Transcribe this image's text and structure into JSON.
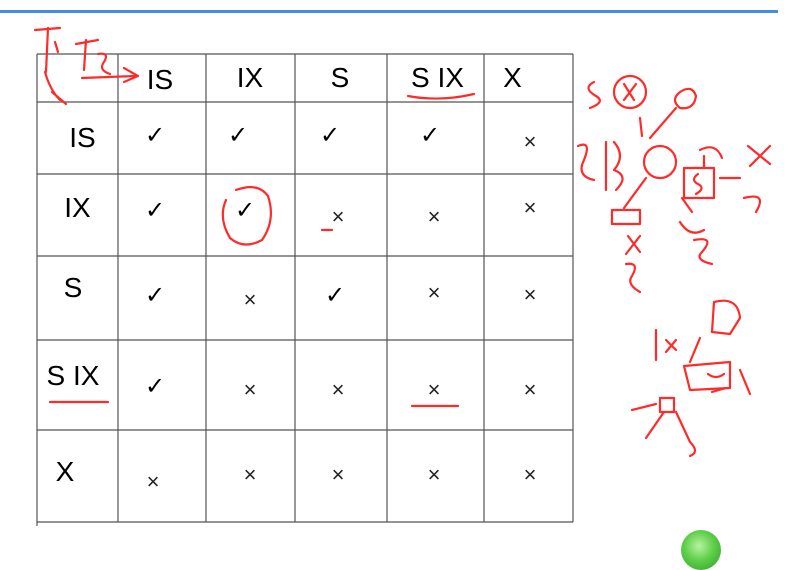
{
  "matrix": {
    "columns": [
      "IS",
      "IX",
      "S",
      "S IX",
      "X"
    ],
    "rows": [
      {
        "label": "IS",
        "cells": [
          "✓",
          "✓",
          "✓",
          "✓",
          "×"
        ]
      },
      {
        "label": "IX",
        "cells": [
          "✓",
          "✓",
          "×",
          "×",
          "×"
        ]
      },
      {
        "label": "S",
        "cells": [
          "✓",
          "×",
          "✓",
          "×",
          "×"
        ]
      },
      {
        "label": "S IX",
        "cells": [
          "✓",
          "×",
          "×",
          "×",
          "×"
        ]
      },
      {
        "label": "X",
        "cells": [
          "×",
          "×",
          "×",
          "×",
          "×"
        ]
      }
    ]
  },
  "colors": {
    "accent_bar": "#3b8fe8",
    "ink": "#000000",
    "annotation": "#ff2a2a",
    "badge": "#5fcf4a"
  },
  "icons": {
    "check": "check-icon",
    "cross": "cross-icon"
  }
}
